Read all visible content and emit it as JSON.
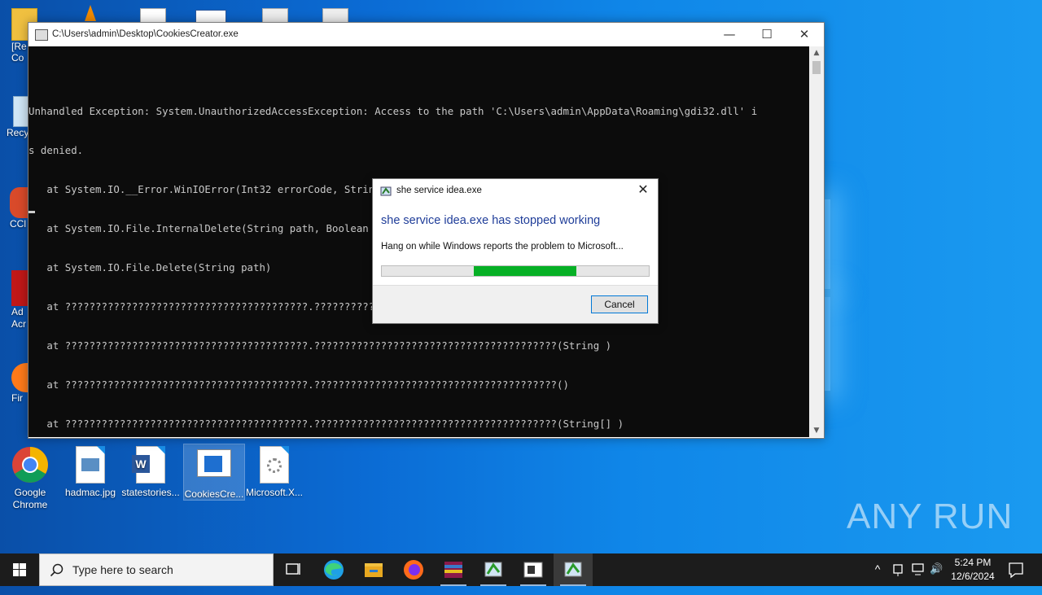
{
  "desktop": {
    "left_icons": [
      {
        "label": "[Re\nCo"
      },
      {
        "label": "Recy"
      },
      {
        "label": "CCl"
      },
      {
        "label": "Ad\nAcr"
      },
      {
        "label": "Fir"
      }
    ],
    "bottom_icons": [
      {
        "label": "Google\nChrome"
      },
      {
        "label": "hadmac.jpg"
      },
      {
        "label": "statestories..."
      },
      {
        "label": "CookiesCre..."
      },
      {
        "label": "Microsoft.X..."
      }
    ]
  },
  "console": {
    "title": "C:\\Users\\admin\\Desktop\\CookiesCreator.exe",
    "lines": [
      "Unhandled Exception: System.UnauthorizedAccessException: Access to the path 'C:\\Users\\admin\\AppData\\Roaming\\gdi32.dll' i",
      "s denied.",
      "   at System.IO.__Error.WinIOError(Int32 errorCode, String maybeFullPath)",
      "   at System.IO.File.InternalDelete(String path, Boolean checkHost)",
      "   at System.IO.File.Delete(String path)",
      "   at ????????????????????????????????????????.????????????????????????????????????????(String )",
      "   at ????????????????????????????????????????.????????????????????????????????????????(String )",
      "   at ????????????????????????????????????????.????????????????????????????????????????()",
      "   at ????????????????????????????????????????.????????????????????????????????????????(String[] )"
    ],
    "minimize_glyph": "—",
    "maximize_glyph": "☐",
    "close_glyph": "✕"
  },
  "dialog": {
    "title": "she service idea.exe",
    "heading": "she service idea.exe has stopped working",
    "message": "Hang on while Windows reports the problem to Microsoft...",
    "cancel_label": "Cancel",
    "close_glyph": "✕",
    "progress_marquee": {
      "start": 0.345,
      "end": 0.73
    },
    "progress_color": "#06b025"
  },
  "watermark": "ANY RUN",
  "taskbar": {
    "search_placeholder": "Type here to search",
    "items": [
      "task-view-icon",
      "edge-icon",
      "file-explorer-icon",
      "firefox-icon",
      "winrar-icon",
      "app-icon",
      "window-app-icon",
      "dotnet-app-icon"
    ],
    "tray": {
      "chevron": "^",
      "volume": "🔊"
    },
    "time": "5:24 PM",
    "date": "12/6/2024"
  }
}
